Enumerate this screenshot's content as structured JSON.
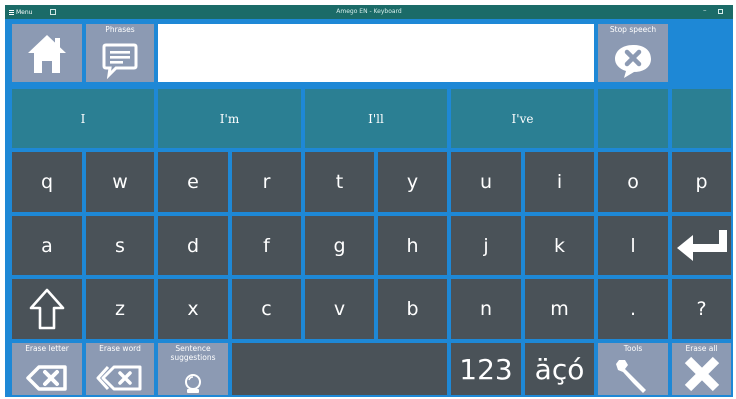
{
  "titlebar": {
    "menu_label": "Menu",
    "title": "Amego EN - Keyboard",
    "minimize_glyph": "–"
  },
  "toolbar": {
    "home_icon": "home-icon",
    "phrases_label": "Phrases",
    "message_value": "",
    "stop_speech_label": "Stop speech"
  },
  "suggestions": [
    "I",
    "I'm",
    "I'll",
    "I've",
    "",
    ""
  ],
  "keyboard": {
    "row1": [
      "q",
      "w",
      "e",
      "r",
      "t",
      "y",
      "u",
      "i",
      "o",
      "p"
    ],
    "row2": [
      "a",
      "s",
      "d",
      "f",
      "g",
      "h",
      "j",
      "k",
      "l"
    ],
    "row3": [
      "z",
      "x",
      "c",
      "v",
      "b",
      "n",
      "m",
      ".",
      "?"
    ]
  },
  "bottom": {
    "erase_letter_label": "Erase letter",
    "erase_word_label": "Erase word",
    "sentence_suggestions_label": "Sentence suggestions",
    "numbers_label": "123",
    "accents_label": "äçó",
    "tools_label": "Tools",
    "erase_all_label": "Erase all"
  },
  "colors": {
    "background": "#1e88d6",
    "key": "#4a5258",
    "tool": "#8c9ab3",
    "suggestion": "#2b7f93",
    "titlebar": "#1b6b68"
  }
}
